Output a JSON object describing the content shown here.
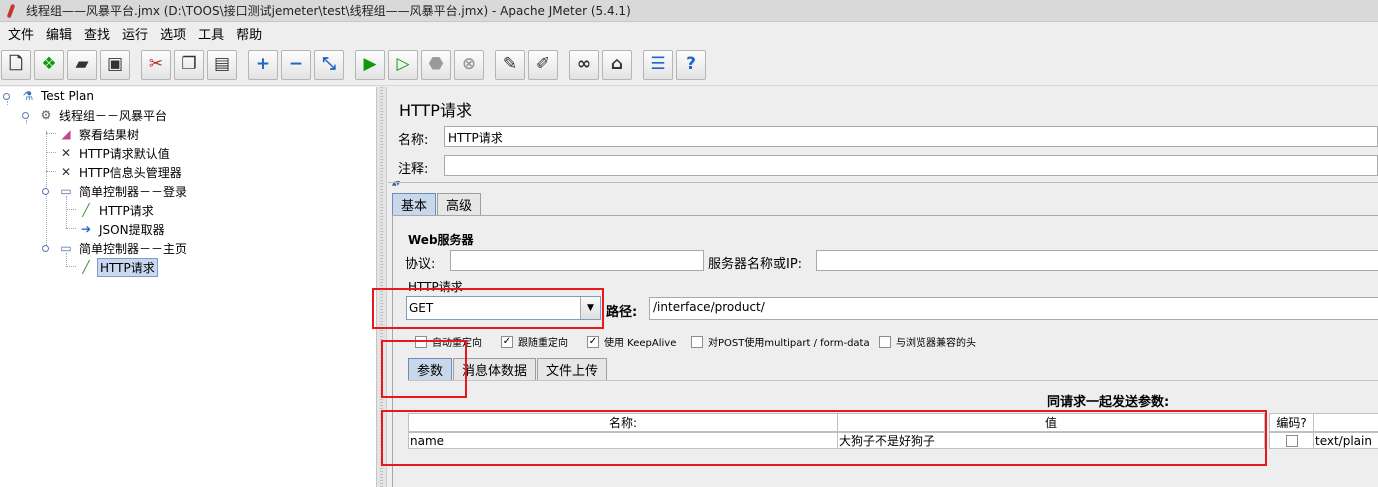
{
  "window": {
    "title": "线程组——风暴平台.jmx (D:\\TOOS\\接口测试jemeter\\test\\线程组——风暴平台.jmx) - Apache JMeter (5.4.1)"
  },
  "menu": {
    "items": [
      "文件",
      "编辑",
      "查找",
      "运行",
      "选项",
      "工具",
      "帮助"
    ]
  },
  "toolbar": {
    "icons": [
      "new-icon",
      "templates-icon",
      "open-icon",
      "save-icon",
      "cut-icon",
      "copy-icon",
      "paste-icon",
      "expand-icon",
      "collapse-icon",
      "toggle-icon",
      "start-icon",
      "start-no-pause-icon",
      "stop-icon",
      "shutdown-icon",
      "clear-icon",
      "clear-all-icon",
      "search-icon",
      "reset-search-icon",
      "function-helper-icon",
      "help-icon"
    ]
  },
  "tree": {
    "nodes": [
      {
        "label": "Test Plan",
        "icon": "test-plan-icon"
      },
      {
        "label": "线程组－－风暴平台",
        "icon": "thread-group-icon"
      },
      {
        "label": "察看结果树",
        "icon": "results-tree-icon"
      },
      {
        "label": "HTTP请求默认值",
        "icon": "config-tools-icon"
      },
      {
        "label": "HTTP信息头管理器",
        "icon": "config-tools-icon"
      },
      {
        "label": "简单控制器－－登录",
        "icon": "controller-icon"
      },
      {
        "label": "HTTP请求",
        "icon": "sampler-pipette-icon"
      },
      {
        "label": "JSON提取器",
        "icon": "extractor-icon"
      },
      {
        "label": "简单控制器－－主页",
        "icon": "controller-icon"
      },
      {
        "label": "HTTP请求",
        "icon": "sampler-pipette-icon",
        "selected": true
      }
    ]
  },
  "panel": {
    "title": "HTTP请求",
    "name_label": "名称:",
    "name_value": "HTTP请求",
    "comment_label": "注释:",
    "comment_value": "",
    "tabs": [
      "基本",
      "高级"
    ],
    "web_server": {
      "group_title": "Web服务器",
      "protocol_label": "协议:",
      "protocol_value": "",
      "server_label": "服务器名称或IP:",
      "server_value": ""
    },
    "http_request": {
      "group_title": "HTTP请求",
      "method": "GET",
      "path_label": "路径:",
      "path_value": "/interface/product/"
    },
    "checkboxes": [
      {
        "label": "自动重定向",
        "checked": false
      },
      {
        "label": "跟随重定向",
        "checked": true
      },
      {
        "label": "使用 KeepAlive",
        "checked": true
      },
      {
        "label": "对POST使用multipart / form-data",
        "checked": false
      },
      {
        "label": "与浏览器兼容的头",
        "checked": false
      }
    ],
    "sub_tabs": [
      "参数",
      "消息体数据",
      "文件上传"
    ],
    "params_caption": "同请求一起发送参数:",
    "table": {
      "headers": [
        "名称:",
        "值",
        "编码?",
        ""
      ],
      "rows": [
        {
          "name": "name",
          "value": "大狗子不是好狗子",
          "encode": false,
          "content_type": "text/plain"
        }
      ]
    }
  },
  "colors": {
    "highlight_box": "#e8181c",
    "selected_tab": "#c9d7ea",
    "tree_selection": "#c9d8ef"
  }
}
